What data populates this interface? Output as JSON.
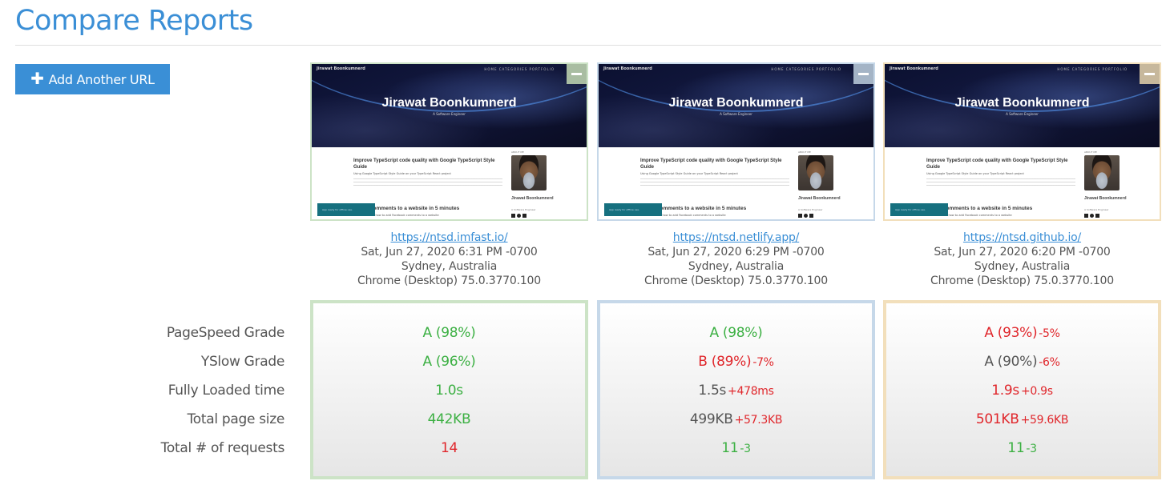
{
  "header": {
    "title": "Compare Reports"
  },
  "toolbar": {
    "add_url_icon": "plus-icon",
    "add_url_label": "Add Another URL"
  },
  "colors": {
    "title": "#3b8fd6",
    "button": "#3a8fd6",
    "good": "#3cb043",
    "bad": "#e0262b",
    "neutral": "#555555",
    "report_1_border": "#cce3c6",
    "report_2_border": "#c6d8e9",
    "report_3_border": "#f2dfbb"
  },
  "screenshot": {
    "site_brand": "Jirawat Boonkumnerd",
    "site_nav": "HOME   CATEGORIES   PORTFOLIO",
    "site_name": "Jirawat Boonkumnerd",
    "site_tagline": "A Software Engineer",
    "post_title": "Improve TypeScript code quality with Google TypeScript Style Guide",
    "post_subtitle": "Using Google TypeScript Style Guide on your TypeScript React project",
    "post2_title": "ebook comments to a website in 5 minutes",
    "post2_subtitle": "A basic tutorial how to add Facebook comments to a website",
    "toast": "App ready for offline use.",
    "about_label": "ABOUT ME",
    "about_name": "Jirawat Boonkumnerd",
    "about_role": "A Software Engineer",
    "collapse_icon": "minus-icon"
  },
  "metric_labels": [
    "PageSpeed Grade",
    "YSlow Grade",
    "Fully Loaded time",
    "Total page size",
    "Total # of requests"
  ],
  "reports": [
    {
      "url": "https://ntsd.imfast.io/",
      "date": "Sat, Jun 27, 2020 6:31 PM -0700",
      "location": "Sydney, Australia",
      "browser": "Chrome (Desktop) 75.0.3770.100",
      "metrics": [
        {
          "value": "A (98%)",
          "delta": "",
          "status": "good"
        },
        {
          "value": "A (96%)",
          "delta": "",
          "status": "good"
        },
        {
          "value": "1.0s",
          "delta": "",
          "status": "good"
        },
        {
          "value": "442KB",
          "delta": "",
          "status": "good"
        },
        {
          "value": "14",
          "delta": "",
          "status": "bad"
        }
      ]
    },
    {
      "url": "https://ntsd.netlify.app/",
      "date": "Sat, Jun 27, 2020 6:29 PM -0700",
      "location": "Sydney, Australia",
      "browser": "Chrome (Desktop) 75.0.3770.100",
      "metrics": [
        {
          "value": "A (98%)",
          "delta": "",
          "status": "good"
        },
        {
          "value": "B (89%)",
          "delta": "-7%",
          "status": "bad"
        },
        {
          "value": "1.5s",
          "delta": "+478ms",
          "status": "neutral",
          "delta_status": "bad"
        },
        {
          "value": "499KB",
          "delta": "+57.3KB",
          "status": "neutral",
          "delta_status": "bad"
        },
        {
          "value": "11",
          "delta": "-3",
          "status": "good"
        }
      ]
    },
    {
      "url": "https://ntsd.github.io/",
      "date": "Sat, Jun 27, 2020 6:20 PM -0700",
      "location": "Sydney, Australia",
      "browser": "Chrome (Desktop) 75.0.3770.100",
      "metrics": [
        {
          "value": "A (93%)",
          "delta": "-5%",
          "status": "bad"
        },
        {
          "value": "A (90%)",
          "delta": "-6%",
          "status": "neutral",
          "delta_status": "bad"
        },
        {
          "value": "1.9s",
          "delta": "+0.9s",
          "status": "bad"
        },
        {
          "value": "501KB",
          "delta": "+59.6KB",
          "status": "bad"
        },
        {
          "value": "11",
          "delta": "-3",
          "status": "good"
        }
      ]
    }
  ]
}
